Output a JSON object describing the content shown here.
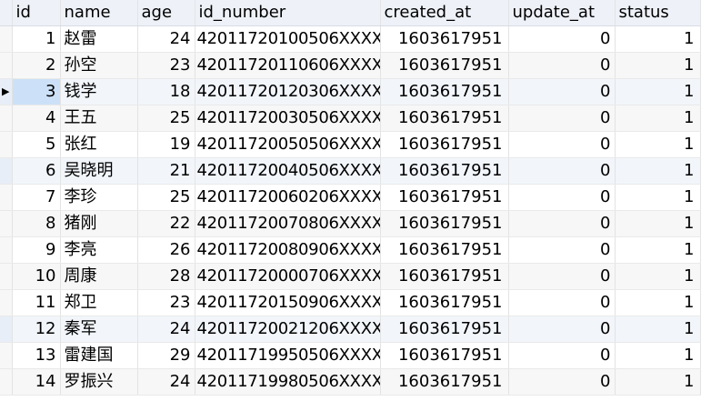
{
  "table": {
    "columns": [
      "id",
      "name",
      "age",
      "id_number",
      "created_at",
      "update_at",
      "status"
    ],
    "current_row_indicator": "▶",
    "rows": [
      {
        "id": "1",
        "name": "赵雷",
        "age": "24",
        "id_number": "42011720100506XXXX",
        "created_at": "1603617951",
        "update_at": "0",
        "status": "1"
      },
      {
        "id": "2",
        "name": "孙空",
        "age": "23",
        "id_number": "42011720110606XXXX",
        "created_at": "1603617951",
        "update_at": "0",
        "status": "1"
      },
      {
        "id": "3",
        "name": "钱学",
        "age": "18",
        "id_number": "42011720120306XXXX",
        "created_at": "1603617951",
        "update_at": "0",
        "status": "1"
      },
      {
        "id": "4",
        "name": "王五",
        "age": "25",
        "id_number": "42011720030506XXXX",
        "created_at": "1603617951",
        "update_at": "0",
        "status": "1"
      },
      {
        "id": "5",
        "name": "张红",
        "age": "19",
        "id_number": "42011720050506XXXX",
        "created_at": "1603617951",
        "update_at": "0",
        "status": "1"
      },
      {
        "id": "6",
        "name": "吴晓明",
        "age": "21",
        "id_number": "42011720040506XXXX",
        "created_at": "1603617951",
        "update_at": "0",
        "status": "1"
      },
      {
        "id": "7",
        "name": "李珍",
        "age": "25",
        "id_number": "42011720060206XXXX",
        "created_at": "1603617951",
        "update_at": "0",
        "status": "1"
      },
      {
        "id": "8",
        "name": "猪刚",
        "age": "22",
        "id_number": "42011720070806XXXX",
        "created_at": "1603617951",
        "update_at": "0",
        "status": "1"
      },
      {
        "id": "9",
        "name": "李亮",
        "age": "26",
        "id_number": "42011720080906XXXX",
        "created_at": "1603617951",
        "update_at": "0",
        "status": "1"
      },
      {
        "id": "10",
        "name": "周康",
        "age": "28",
        "id_number": "42011720000706XXXX",
        "created_at": "1603617951",
        "update_at": "0",
        "status": "1"
      },
      {
        "id": "11",
        "name": "郑卫",
        "age": "23",
        "id_number": "42011720150906XXXX",
        "created_at": "1603617951",
        "update_at": "0",
        "status": "1"
      },
      {
        "id": "12",
        "name": "秦军",
        "age": "24",
        "id_number": "42011720021206XXXX",
        "created_at": "1603617951",
        "update_at": "0",
        "status": "1"
      },
      {
        "id": "13",
        "name": "雷建国",
        "age": "29",
        "id_number": "42011719950506XXXX",
        "created_at": "1603617951",
        "update_at": "0",
        "status": "1"
      },
      {
        "id": "14",
        "name": "罗振兴",
        "age": "24",
        "id_number": "42011719980506XXXX",
        "created_at": "1603617951",
        "update_at": "0",
        "status": "1"
      }
    ]
  }
}
